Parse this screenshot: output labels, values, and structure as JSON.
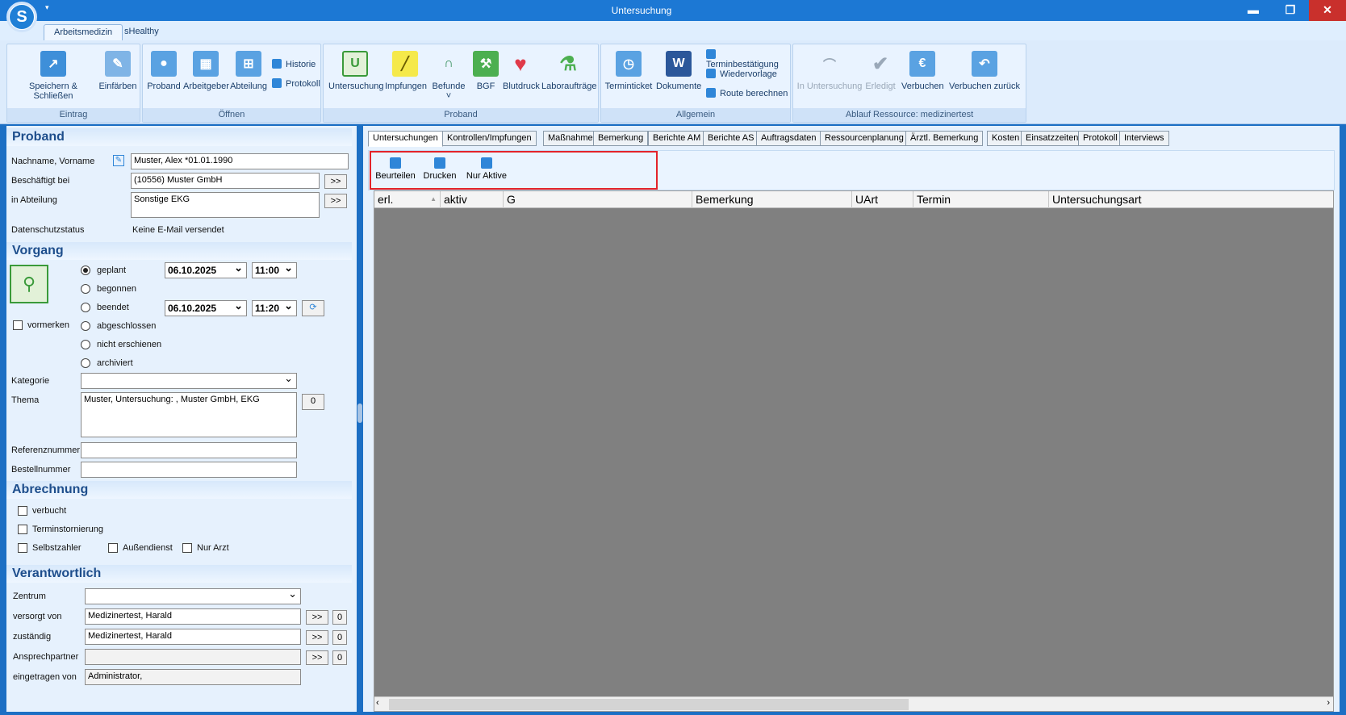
{
  "window": {
    "title": "Untersuchung",
    "logo": "S",
    "qat": "▾",
    "controls": {
      "minimize": "▬",
      "maximize": "❐",
      "close": "✕"
    }
  },
  "ribbon_tabs": [
    "Arbeitsmedizin",
    "sHealthy"
  ],
  "groups": {
    "eintrag": {
      "label": "Eintrag",
      "buttons": [
        "Speichern & Schließen",
        "Einfärben"
      ]
    },
    "oeffnen": {
      "label": "Öffnen",
      "buttons": [
        "Proband",
        "Arbeitgeber",
        "Abteilung"
      ],
      "small": [
        "Historie",
        "Protokoll"
      ]
    },
    "proband": {
      "label": "Proband",
      "buttons": [
        "Untersuchung",
        "Impfungen",
        "Befunde ˅",
        "BGF",
        "Blutdruck",
        "Laboraufträge"
      ]
    },
    "allgemein": {
      "label": "Allgemein",
      "buttons": [
        "Terminticket",
        "Dokumente"
      ],
      "small": [
        "Terminbestätigung",
        "Wiedervorlage",
        "Route berechnen"
      ]
    },
    "ablauf": {
      "label": "Ablauf Ressource: medizinertest",
      "buttons": [
        "In Untersuchung",
        "Erledigt",
        "Verbuchen",
        "Verbuchen zurück"
      ]
    }
  },
  "proband": {
    "header": "Proband",
    "name_label": "Nachname, Vorname",
    "name_value": "Muster, Alex *01.01.1990",
    "employer_label": "Beschäftigt bei",
    "employer_value": "(10556) Muster GmbH",
    "dept_label": "in Abteilung",
    "dept_value": "Sonstige EKG",
    "privacy_label": "Datenschutzstatus",
    "privacy_value": "Keine E-Mail versendet",
    "more": ">>"
  },
  "vorgang": {
    "header": "Vorgang",
    "status": [
      "geplant",
      "begonnen",
      "beendet",
      "abgeschlossen",
      "nicht erschienen",
      "archiviert"
    ],
    "selected": "geplant",
    "planned_date": "06.10.2025",
    "planned_time": "11:00",
    "end_date": "06.10.2025",
    "end_time": "11:20",
    "vormerken": "vormerken",
    "kategorie_label": "Kategorie",
    "thema_label": "Thema",
    "thema_value": "Muster, Untersuchung: , Muster GmbH, EKG",
    "thema_count": "0",
    "ref_label": "Referenznummer",
    "order_label": "Bestellnummer"
  },
  "abrechnung": {
    "header": "Abrechnung",
    "checks": [
      "verbucht",
      "Terminstornierung",
      "Selbstzahler",
      "Außendienst",
      "Nur Arzt"
    ]
  },
  "verantwortlich": {
    "header": "Verantwortlich",
    "zentrum_label": "Zentrum",
    "versorgt_label": "versorgt von",
    "versorgt_value": "Medizinertest, Harald",
    "zustaendig_label": "zuständig",
    "zustaendig_value": "Medizinertest, Harald",
    "ansprech_label": "Ansprechpartner",
    "eingetragen_label": "eingetragen von",
    "eingetragen_value": "Administrator,",
    "count": "0",
    "more": ">>"
  },
  "tabs": [
    "Untersuchungen",
    "Kontrollen/Impfungen",
    "Maßnahmen",
    "Bemerkung",
    "Berichte AM",
    "Berichte AS",
    "Auftragsdaten",
    "Ressourcenplanung",
    "Ärztl. Bemerkung",
    "Kosten",
    "Einsatzzeiten",
    "Protokoll",
    "Interviews"
  ],
  "toolbar": [
    "Beurteilen",
    "Drucken",
    "Nur Aktive"
  ],
  "grid_columns": [
    "erl.",
    "aktiv",
    "G",
    "Bemerkung",
    "UArt",
    "Termin",
    "Untersuchungsart"
  ],
  "colors": {
    "accent": "#1c78d4",
    "highlight": "#e3232a"
  }
}
